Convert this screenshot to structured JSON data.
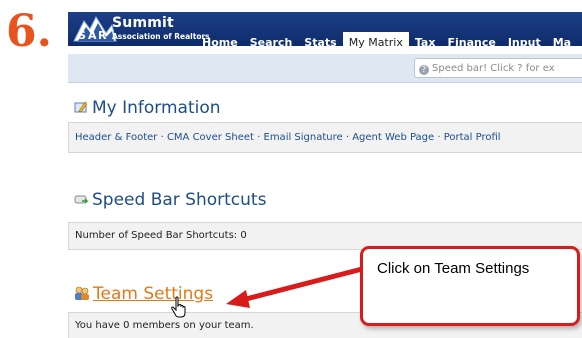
{
  "step_number": "6.",
  "logo": {
    "name": "Summit",
    "subtitle": "Association of Realtors"
  },
  "nav": {
    "tabs": [
      "Home",
      "Search",
      "Stats",
      "My Matrix",
      "Tax",
      "Finance",
      "Input",
      "Ma"
    ],
    "active": "My Matrix"
  },
  "speedbar": {
    "placeholder": "Speed bar! Click ? for ex"
  },
  "my_information": {
    "title": "My Information",
    "links": [
      "Header & Footer",
      "CMA Cover Sheet",
      "Email Signature",
      "Agent Web Page",
      "Portal Profil"
    ]
  },
  "speed_bar_shortcuts": {
    "title": "Speed Bar Shortcuts",
    "count_text": "Number of Speed Bar Shortcuts: 0"
  },
  "team_settings": {
    "title": "Team Settings",
    "members_text": "You have 0 members on your team."
  },
  "callout": {
    "text": "Click on Team Settings"
  },
  "colors": {
    "accent": "#e8541e",
    "link": "#1c4e8c",
    "team_link": "#e77817",
    "callout_border": "#d81b1b",
    "nav_bg": "#0e2c6c"
  },
  "icons": [
    "my-information-icon",
    "speed-bar-icon",
    "team-icon",
    "hand-cursor-icon",
    "red-arrow-icon"
  ]
}
